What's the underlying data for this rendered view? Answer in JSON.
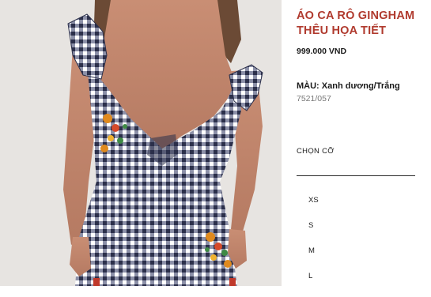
{
  "product": {
    "title_line1": "ÁO CA RÔ GINGHAM",
    "title_line2": "THÊU HỌA TIẾT",
    "price": "999.000 VND",
    "color_label": "MÀU:",
    "color_value": "Xanh dương/Trắng",
    "reference": "7521/057",
    "size_heading": "CHỌN CỠ",
    "sizes": [
      "XS",
      "S",
      "M",
      "L"
    ]
  },
  "colors": {
    "title": "#b03a2e",
    "gingham_dark": "#2b2f4a",
    "gingham_light": "#ffffff"
  }
}
